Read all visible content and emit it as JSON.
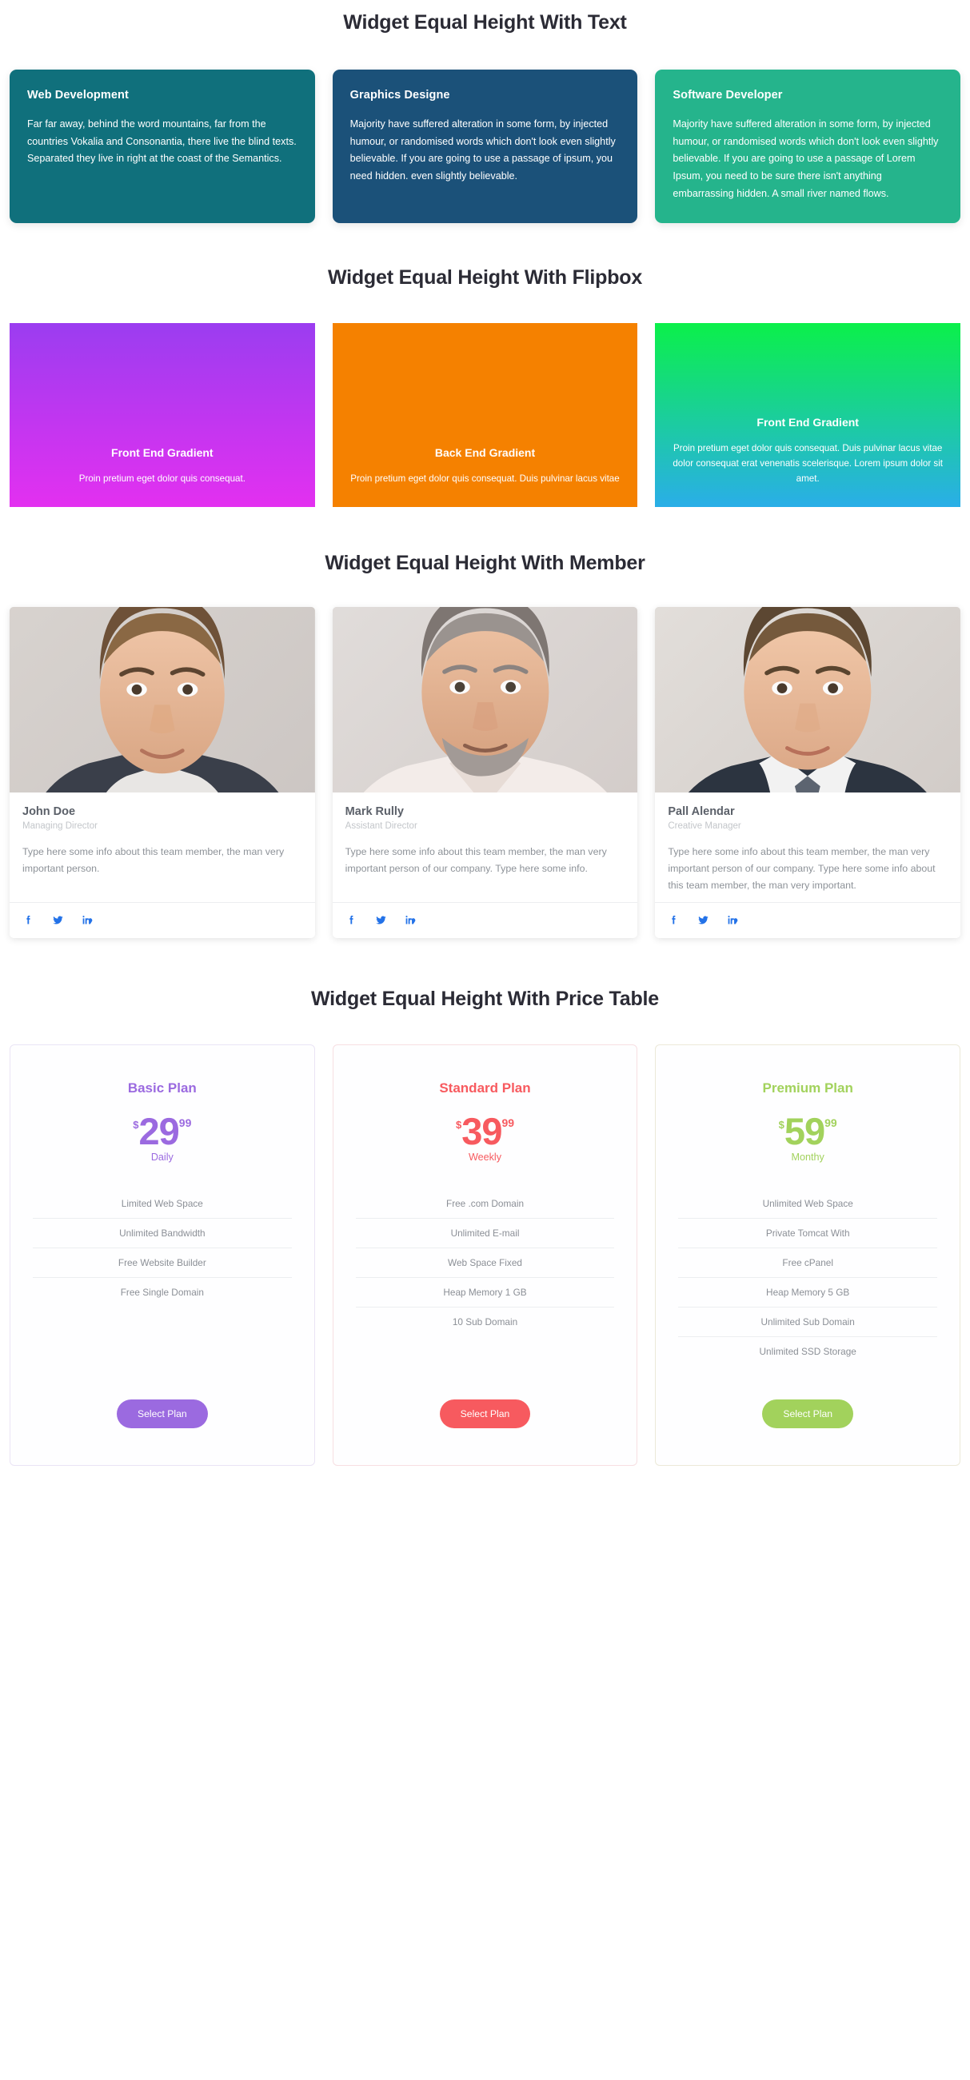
{
  "sections": {
    "text": {
      "title": "Widget Equal Height With Text",
      "cards": [
        {
          "title": "Web Development",
          "body": "Far far away, behind the word mountains, far from the countries Vokalia and Consonantia, there live the blind texts. Separated they live in right at the coast of the Semantics.",
          "bg": "#10707c"
        },
        {
          "title": "Graphics Designe",
          "body": "Majority have suffered alteration in some form, by injected humour, or randomised words which don't look even slightly believable. If you are going to use a passage of ipsum, you need hidden. even slightly believable.",
          "bg": "#1b5179"
        },
        {
          "title": "Software Developer",
          "body": "Majority have suffered alteration in some form, by injected humour, or randomised words which don't look even slightly believable. If you are going to use a passage of Lorem Ipsum, you need to be sure there isn't anything embarrassing hidden. A small river named flows.",
          "bg": "#25b48c"
        }
      ]
    },
    "flipbox": {
      "title": "Widget Equal Height With Flipbox",
      "cards": [
        {
          "title": "Front End Gradient",
          "body": "Proin pretium eget dolor quis consequat.",
          "gradient_from": "#9b3df0",
          "gradient_to": "#e330f0"
        },
        {
          "title": "Back End Gradient",
          "body": "Proin pretium eget dolor quis consequat. Duis pulvinar lacus vitae",
          "gradient_from": "#f58100",
          "gradient_to": "#f58100"
        },
        {
          "title": "Front End Gradient",
          "body": "Proin pretium eget dolor quis consequat. Duis pulvinar lacus vitae dolor consequat erat venenatis scelerisque. Lorem ipsum dolor sit amet.",
          "gradient_from": "#0bf04a",
          "gradient_to": "#2aaee8"
        }
      ]
    },
    "member": {
      "title": "Widget Equal Height With Member",
      "social_icons": [
        "facebook-icon",
        "twitter-icon",
        "linkedin-icon"
      ],
      "social_color": "#2372e8",
      "cards": [
        {
          "name": "John Doe",
          "role": "Managing Director",
          "desc": "Type here some info about this team member, the man very important person.",
          "photo_alt": "portrait-young-man"
        },
        {
          "name": "Mark Rully",
          "role": "Assistant Director",
          "desc": "Type here some info about this team member, the man very important person of our company. Type here some info.",
          "photo_alt": "portrait-middle-aged-man"
        },
        {
          "name": "Pall Alendar",
          "role": "Creative Manager",
          "desc": "Type here some info about this team member, the man very important person of our company. Type here some info about this team member, the man very important.",
          "photo_alt": "portrait-young-man-suit"
        }
      ]
    },
    "price": {
      "title": "Widget Equal Height With Price Table",
      "cards": [
        {
          "plan": "Basic Plan",
          "currency": "$",
          "amount": "29",
          "cents": "99",
          "period": "Daily",
          "color": "#9b6ae0",
          "border": "#eae4f5",
          "button_label": "Select Plan",
          "features": [
            "Limited Web Space",
            "Unlimited Bandwidth",
            "Free Website Builder",
            "Free Single Domain"
          ]
        },
        {
          "plan": "Standard Plan",
          "currency": "$",
          "amount": "39",
          "cents": "99",
          "period": "Weekly",
          "color": "#f75a5f",
          "border": "#f7dfe2",
          "button_label": "Select Plan",
          "features": [
            "Free .com Domain",
            "Unlimited E-mail",
            "Web Space Fixed",
            "Heap Memory 1 GB",
            "10 Sub Domain"
          ]
        },
        {
          "plan": "Premium Plan",
          "currency": "$",
          "amount": "59",
          "cents": "99",
          "period": "Monthy",
          "color": "#a2d25c",
          "border": "#ece9d8",
          "button_label": "Select Plan",
          "features": [
            "Unlimited Web Space",
            "Private Tomcat With",
            "Free cPanel",
            "Heap Memory 5 GB",
            "Unlimited Sub Domain",
            "Unlimited SSD Storage"
          ]
        }
      ]
    }
  }
}
